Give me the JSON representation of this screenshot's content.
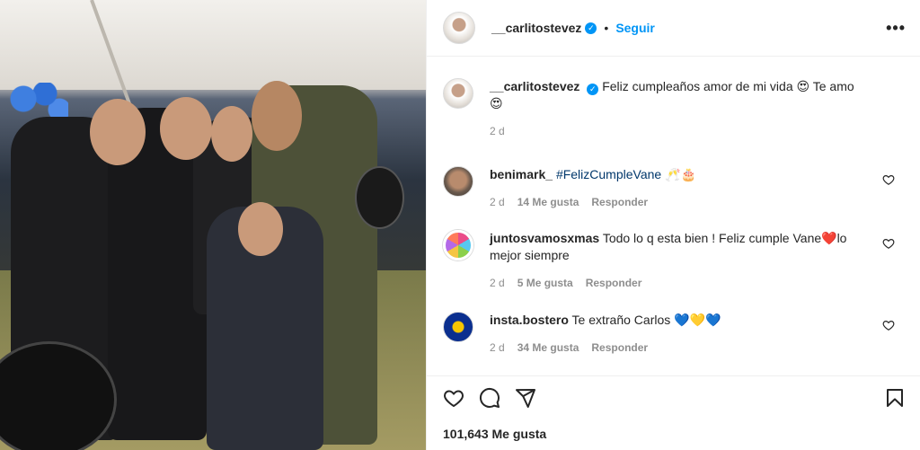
{
  "post": {
    "username": "__carlitostevez",
    "follow_label": "Seguir",
    "separator": "•",
    "more_label": "•••"
  },
  "caption": {
    "username": "__carlitostevez",
    "text": "Feliz cumpleaños amor de mi vida 😍 Te amo 😍",
    "time": "2 d"
  },
  "comments": [
    {
      "username": "benimark_",
      "text": "#FelizCumpleVane 🥂🎂",
      "time": "2 d",
      "likes": "14 Me gusta",
      "reply": "Responder"
    },
    {
      "username": "juntosvamosxmas",
      "text": "Todo lo q esta bien ! Feliz cumple Vane❤️lo mejor siempre",
      "time": "2 d",
      "likes": "5 Me gusta",
      "reply": "Responder"
    },
    {
      "username": "insta.bostero",
      "text": "Te extraño Carlos 💙💛💙",
      "time": "2 d",
      "likes": "34 Me gusta",
      "reply": "Responder"
    }
  ],
  "footer": {
    "likes": "101,643 Me gusta"
  },
  "icons": {
    "verified": "verified-badge-icon",
    "heart": "heart-icon",
    "comment": "comment-icon",
    "share": "share-icon",
    "bookmark": "bookmark-icon"
  }
}
